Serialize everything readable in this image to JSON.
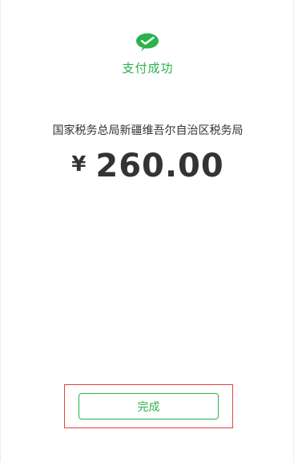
{
  "payment_result": {
    "status_text": "支付成功",
    "payee": "国家税务总局新疆维吾尔自治区税务局",
    "currency_symbol": "¥",
    "amount": "260.00",
    "done_button_label": "完成",
    "logo_icon": "wechat-pay-check-icon"
  },
  "colors": {
    "brand_green": "#2bb24c",
    "text_dark": "#333333",
    "highlight_red": "#e04444"
  }
}
